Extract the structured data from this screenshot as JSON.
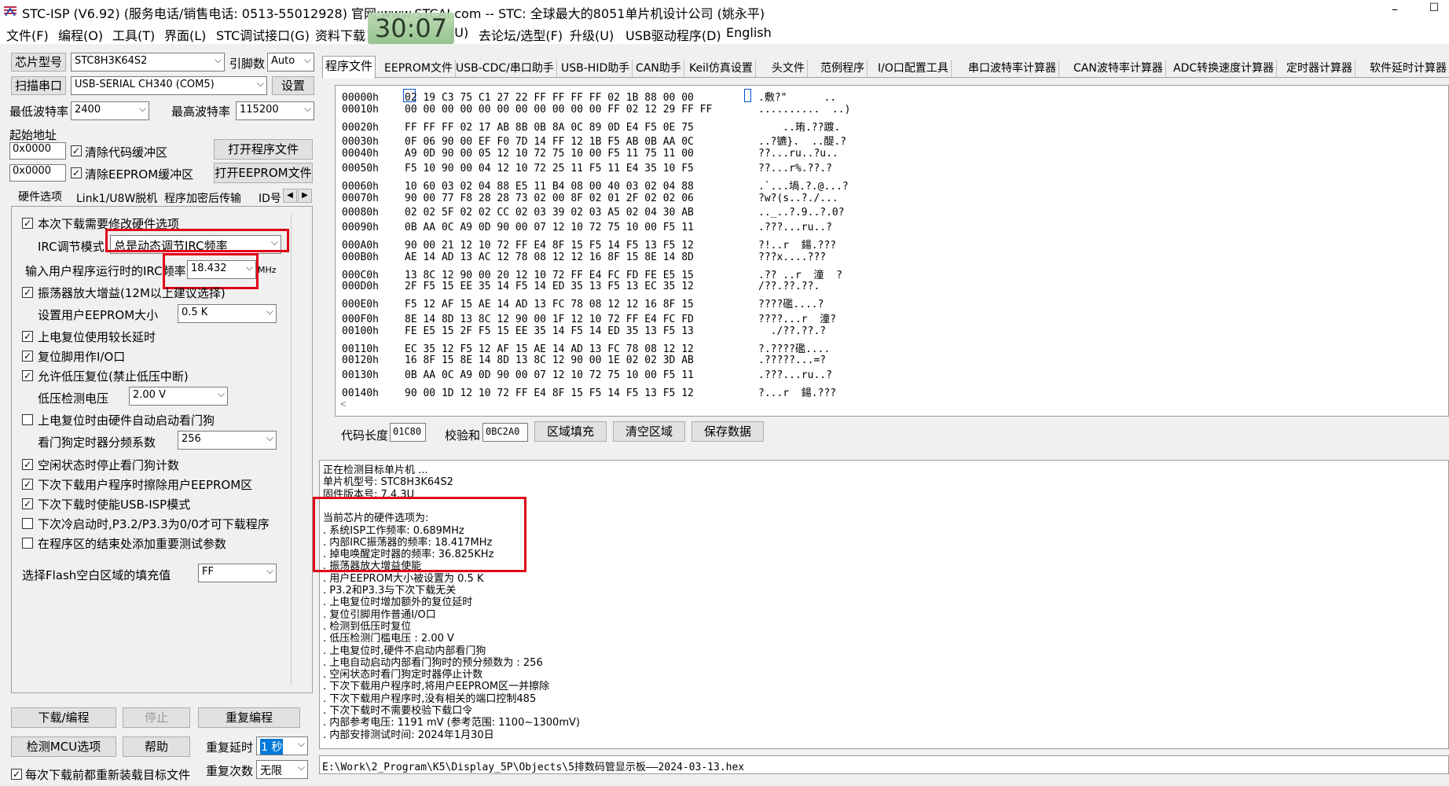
{
  "window": {
    "title": "STC-ISP (V6.92) (服务电话/销售电话: 0513-55012928) 官网:www.STCAI.com  -- STC: 全球最大的8051单片机设计公司 (姚永平)",
    "clock": "30:07",
    "min": "–",
    "max": "☐"
  },
  "menu": [
    "文件(F)",
    "编程(O)",
    "工具(T)",
    "界面(L)",
    "STC调试接口(G)",
    "资料下载",
    "(U)",
    "去论坛/选型(F)",
    "升级(U)",
    "USB驱动程序(D)",
    "English"
  ],
  "left": {
    "chip_label": "芯片型号",
    "chip_value": "STC8H3K64S2",
    "pin_label": "引脚数",
    "pin_value": "Auto",
    "scan_button": "扫描串口",
    "port_value": "USB-SERIAL CH340 (COM5)",
    "settings_button": "设置",
    "min_baud_label": "最低波特率",
    "min_baud_value": "2400",
    "max_baud_label": "最高波特率",
    "max_baud_value": "115200",
    "start_addr_label": "起始地址",
    "addr1": "0x0000",
    "clear_code_label": "清除代码缓冲区",
    "open_prog_button": "打开程序文件",
    "addr2": "0x0000",
    "clear_eeprom_label": "清除EEPROM缓冲区",
    "open_eeprom_button": "打开EEPROM文件",
    "tabs": [
      "硬件选项",
      "Link1/U8W脱机",
      "程序加密后传输",
      "ID号"
    ],
    "options": {
      "modify_hw": "本次下载需要修改硬件选项",
      "irc_mode_label": "IRC调节模式",
      "irc_mode_value": "总是动态调节IRC频率",
      "irc_freq_label": "输入用户程序运行时的IRC频率",
      "irc_freq_value": "18.432",
      "irc_freq_unit": "MHz",
      "osc_gain": "振荡器放大增益(12M以上建议选择)",
      "eeprom_size_label": "设置用户EEPROM大小",
      "eeprom_size_value": "0.5 K",
      "por_delay": "上电复位使用较长延时",
      "reset_pin_io": "复位脚用作I/O口",
      "lvr": "允许低压复位(禁止低压中断)",
      "lvd_label": "低压检测电压",
      "lvd_value": "2.00 V",
      "wdt_auto": "上电复位时由硬件自动启动看门狗",
      "wdt_div_label": "看门狗定时器分频系数",
      "wdt_div_value": "256",
      "idle_wdt": "空闲状态时停止看门狗计数",
      "erase_eeprom": "下次下载用户程序时擦除用户EEPROM区",
      "usb_isp": "下次下载时使能USB-ISP模式",
      "cold_boot": "下次冷启动时,P3.2/P3.3为0/0才可下载程序",
      "test_params": "在程序区的结束处添加重要测试参数",
      "fill_label": "选择Flash空白区域的填充值",
      "fill_value": "FF"
    },
    "download_button": "下载/编程",
    "stop_button": "停止",
    "repeat_button": "重复编程",
    "detect_button": "检测MCU选项",
    "help_button": "帮助",
    "repeat_delay_label": "重复延时",
    "repeat_delay_value": "1 秒",
    "reload_label": "每次下载前都重新装载目标文件",
    "repeat_count_label": "重复次数",
    "repeat_count_value": "无限"
  },
  "tabs": [
    "程序文件",
    "EEPROM文件",
    "USB-CDC/串口助手",
    "USB-HID助手",
    "CAN助手",
    "Keil仿真设置",
    "头文件",
    "范例程序",
    "I/O口配置工具",
    "串口波特率计算器",
    "CAN波特率计算器",
    "ADC转换速度计算器",
    "定时器计算器",
    "软件延时计算器"
  ],
  "hex_rows": [
    {
      "addr": "00000h",
      "bytes": "02 19 C3 75 C1 27 22 FF FF FF FF 02 1B 88 00 00",
      "ascii": ".敷?\"      .."
    },
    {
      "addr": "00010h",
      "bytes": "00 00 00 00 00 00 00 00 00 00 00 FF 02 12 29 FF FF",
      "ascii": "..........  ..)"
    },
    {
      "addr": "00020h",
      "bytes": "FF FF FF 02 17 AB 8B 0B 8A 0C 89 0D E4 F5 0E 75",
      "ascii": "    ..珛.??踱."
    },
    {
      "addr": "00030h",
      "bytes": "0F 06 90 00 EF F0 7D 14 FF 12 1B F5 AB 0B AA 0C",
      "ascii": "..?镳}.  ..醍.?"
    },
    {
      "addr": "00040h",
      "bytes": "A9 0D 90 00 05 12 10 72 75 10 00 F5 11 75 11 00",
      "ascii": "??...ru..?u.."
    },
    {
      "addr": "00050h",
      "bytes": "F5 10 90 00 04 12 10 72 25 11 F5 11 E4 35 10 F5",
      "ascii": "??...r%.??.?"
    },
    {
      "addr": "00060h",
      "bytes": "10 60 03 02 04 88 E5 11 B4 08 00 40 03 02 04 88",
      "ascii": ".`...堝.?.@...?"
    },
    {
      "addr": "00070h",
      "bytes": "90 00 77 F8 28 28 73 02 00 8F 02 01 2F 02 02 06",
      "ascii": "?w?(s..?./..."
    },
    {
      "addr": "00080h",
      "bytes": "02 02 5F 02 02 CC 02 03 39 02 03 A5 02 04 30 AB",
      "ascii": ".._..?.9..?.0?"
    },
    {
      "addr": "00090h",
      "bytes": "0B AA 0C A9 0D 90 00 07 12 10 72 75 10 00 F5 11",
      "ascii": ".???...ru..?"
    },
    {
      "addr": "000A0h",
      "bytes": "90 00 21 12 10 72 FF E4 8F 15 F5 14 F5 13 F5 12",
      "ascii": "?!..r  鍚.???"
    },
    {
      "addr": "000B0h",
      "bytes": "AE 14 AD 13 AC 12 78 08 12 12 16 8F 15 8E 14 8D",
      "ascii": "???x....???"
    },
    {
      "addr": "000C0h",
      "bytes": "13 8C 12 90 00 20 12 10 72 FF E4 FC FD FE E5 15",
      "ascii": ".?? ..r  潼  ?"
    },
    {
      "addr": "000D0h",
      "bytes": "2F F5 15 EE 35 14 F5 14 ED 35 13 F5 13 EC 35 12",
      "ascii": "/??.??.??."
    },
    {
      "addr": "000E0h",
      "bytes": "F5 12 AF 15 AE 14 AD 13 FC 78 08 12 12 16 8F 15",
      "ascii": "????礛....?"
    },
    {
      "addr": "000F0h",
      "bytes": "8E 14 8D 13 8C 12 90 00 1F 12 10 72 FF E4 FC FD",
      "ascii": "????...r  潼?"
    },
    {
      "addr": "00100h",
      "bytes": "FE E5 15 2F F5 15 EE 35 14 F5 14 ED 35 13 F5 13",
      "ascii": "  ./??.??.?"
    },
    {
      "addr": "00110h",
      "bytes": "EC 35 12 F5 12 AF 15 AE 14 AD 13 FC 78 08 12 12",
      "ascii": "?.????礛...."
    },
    {
      "addr": "00120h",
      "bytes": "16 8F 15 8E 14 8D 13 8C 12 90 00 1E 02 02 3D AB",
      "ascii": ".?????...=?"
    },
    {
      "addr": "00130h",
      "bytes": "0B AA 0C A9 0D 90 00 07 12 10 72 75 10 00 F5 11",
      "ascii": ".???...ru..?"
    },
    {
      "addr": "00140h",
      "bytes": "90 00 1D 12 10 72 FF E4 8F 15 F5 14 F5 13 F5 12",
      "ascii": "?...r  鍚.???"
    }
  ],
  "hex_scroll_left": "<",
  "bottom_bar": {
    "code_len_label": "代码长度",
    "code_len_value": "01C80",
    "checksum_label": "校验和",
    "checksum_value": "0BC2A0",
    "fill_button": "区域填充",
    "clear_button": "清空区域",
    "save_button": "保存数据"
  },
  "log": [
    "正在检测目标单片机 ...",
    "  单片机型号: STC8H3K64S2",
    "  固件版本号: 7.4.3U",
    "",
    "当前芯片的硬件选项为:",
    "  . 系统ISP工作频率: 0.689MHz",
    "  . 内部IRC振荡器的频率: 18.417MHz",
    "  . 掉电唤醒定时器的频率: 36.825KHz",
    "  . 振荡器放大增益使能",
    "  . 用户EEPROM大小被设置为 0.5 K",
    "  . P3.2和P3.3与下次下载无关",
    "  . 上电复位时增加额外的复位延时",
    "  . 复位引脚用作普通I/O口",
    "  . 检测到低压时复位",
    "  . 低压检测门槛电压 : 2.00 V",
    "  . 上电复位时,硬件不启动内部看门狗",
    "  . 上电自动启动内部看门狗时的预分频数为 : 256",
    "  . 空闲状态时看门狗定时器停止计数",
    "  . 下次下载用户程序时,将用户EEPROM区一并擦除",
    "  . 下次下载用户程序时,没有相关的端口控制485",
    "  . 下次下载时不需要校验下载口令",
    "  . 内部参考电压: 1191 mV (参考范围: 1100~1300mV)",
    "  . 内部安排测试时间: 2024年1月30日"
  ],
  "path": "E:\\Work\\2_Program\\K5\\Display_5P\\Objects\\5排数码管显示板——2024-03-13.hex",
  "checkmark": "✓"
}
